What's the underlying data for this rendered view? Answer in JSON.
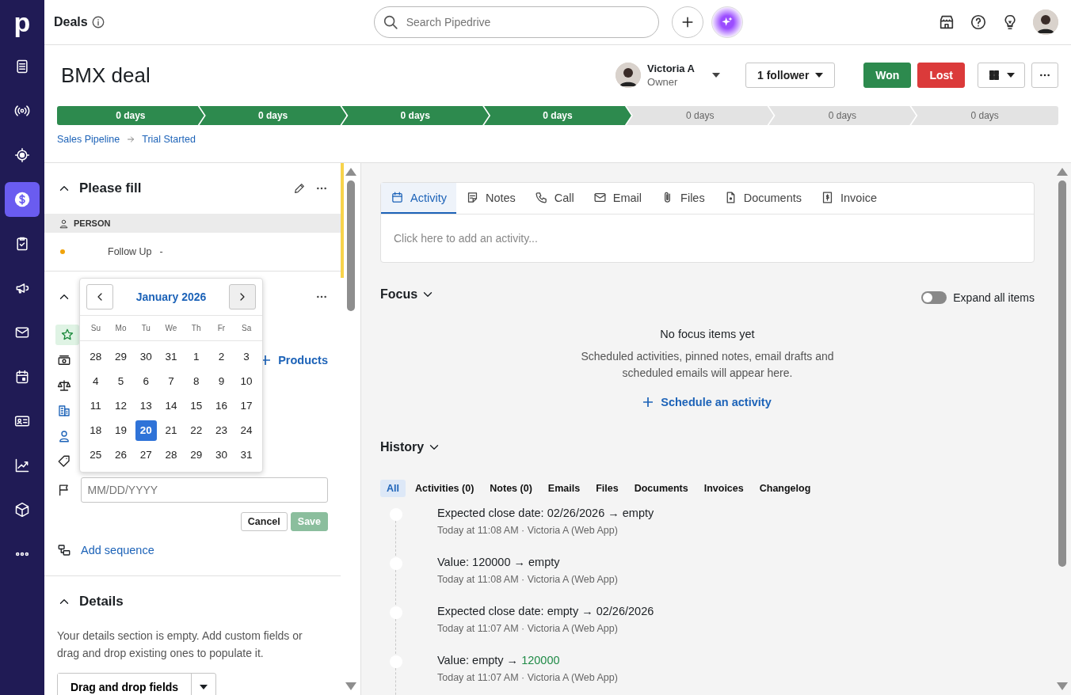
{
  "topbar": {
    "title": "Deals",
    "search": {
      "placeholder": "Search Pipedrive"
    }
  },
  "nav": {
    "logo": "p",
    "items": [
      {
        "kind": "leads",
        "selected": false
      },
      {
        "kind": "broadcast",
        "selected": false
      },
      {
        "kind": "target",
        "selected": false
      },
      {
        "kind": "deals",
        "selected": true
      },
      {
        "kind": "tasks",
        "selected": false
      },
      {
        "kind": "campaigns",
        "selected": false
      },
      {
        "kind": "mail",
        "selected": false
      },
      {
        "kind": "calendar",
        "selected": false
      },
      {
        "kind": "contacts",
        "selected": false
      },
      {
        "kind": "insights",
        "selected": false
      },
      {
        "kind": "products",
        "selected": false
      },
      {
        "kind": "more",
        "selected": false
      }
    ]
  },
  "deal": {
    "title": "BMX deal",
    "owner": {
      "name": "Victoria A",
      "role": "Owner"
    },
    "followers": "1 follower",
    "won": "Won",
    "lost": "Lost"
  },
  "pipeline": {
    "stages": [
      {
        "label": "0 days",
        "done": true
      },
      {
        "label": "0 days",
        "done": true
      },
      {
        "label": "0 days",
        "done": true
      },
      {
        "label": "0 days",
        "done": true
      },
      {
        "label": "0 days",
        "done": false
      },
      {
        "label": "0 days",
        "done": false
      },
      {
        "label": "0 days",
        "done": false
      }
    ]
  },
  "breadcrumb": [
    "Sales Pipeline",
    "Trial Started"
  ],
  "sidebar": {
    "please_fill": {
      "title": "Please fill",
      "group": "PERSON",
      "fields": [
        {
          "label": "Follow Up",
          "value": "-",
          "color": "#f0a30a"
        }
      ]
    },
    "summary": {
      "products_link": "Products",
      "date_field": {
        "placeholder": "MM/DD/YYYY"
      },
      "cancel": "Cancel",
      "save": {
        "label": "Save",
        "disabled": true
      },
      "sequence_link": "Add sequence"
    },
    "details": {
      "title": "Details",
      "text": "Your details section is empty. Add custom fields or drag and drop existing ones to populate it.",
      "button": "Drag and drop fields"
    }
  },
  "calendar": {
    "month": "January 2026",
    "weekdays": [
      "Su",
      "Mo",
      "Tu",
      "We",
      "Th",
      "Fr",
      "Sa"
    ],
    "weeks": [
      [
        {
          "day": "28",
          "selected": false
        },
        {
          "day": "29",
          "selected": false
        },
        {
          "day": "30",
          "selected": false
        },
        {
          "day": "31",
          "selected": false
        },
        {
          "day": "1",
          "selected": false
        },
        {
          "day": "2",
          "selected": false
        },
        {
          "day": "3",
          "selected": false
        }
      ],
      [
        {
          "day": "4",
          "selected": false
        },
        {
          "day": "5",
          "selected": false
        },
        {
          "day": "6",
          "selected": false
        },
        {
          "day": "7",
          "selected": false
        },
        {
          "day": "8",
          "selected": false
        },
        {
          "day": "9",
          "selected": false
        },
        {
          "day": "10",
          "selected": false
        }
      ],
      [
        {
          "day": "11",
          "selected": false
        },
        {
          "day": "12",
          "selected": false
        },
        {
          "day": "13",
          "selected": false
        },
        {
          "day": "14",
          "selected": false
        },
        {
          "day": "15",
          "selected": false
        },
        {
          "day": "16",
          "selected": false
        },
        {
          "day": "17",
          "selected": false
        }
      ],
      [
        {
          "day": "18",
          "selected": false
        },
        {
          "day": "19",
          "selected": false
        },
        {
          "day": "20",
          "selected": true
        },
        {
          "day": "21",
          "selected": false
        },
        {
          "day": "22",
          "selected": false
        },
        {
          "day": "23",
          "selected": false
        },
        {
          "day": "24",
          "selected": false
        }
      ],
      [
        {
          "day": "25",
          "selected": false
        },
        {
          "day": "26",
          "selected": false
        },
        {
          "day": "27",
          "selected": false
        },
        {
          "day": "28",
          "selected": false
        },
        {
          "day": "29",
          "selected": false
        },
        {
          "day": "30",
          "selected": false
        },
        {
          "day": "31",
          "selected": false
        }
      ]
    ]
  },
  "composer": {
    "tabs": [
      {
        "label": "Activity",
        "kind": "activity",
        "selected": true
      },
      {
        "label": "Notes",
        "kind": "notes",
        "selected": false
      },
      {
        "label": "Call",
        "kind": "call",
        "selected": false
      },
      {
        "label": "Email",
        "kind": "email",
        "selected": false
      },
      {
        "label": "Files",
        "kind": "files",
        "selected": false
      },
      {
        "label": "Documents",
        "kind": "documents",
        "selected": false
      },
      {
        "label": "Invoice",
        "kind": "invoice",
        "selected": false
      }
    ],
    "placeholder": "Click here to add an activity..."
  },
  "focus": {
    "title": "Focus",
    "expand": {
      "label": "Expand all items",
      "on": false
    },
    "empty_title": "No focus items yet",
    "empty_text": "Scheduled activities, pinned notes, email drafts and scheduled emails will appear here.",
    "action": "Schedule an activity"
  },
  "history": {
    "title": "History",
    "filters": [
      {
        "label": "All",
        "selected": true
      },
      {
        "label": "Activities (0)",
        "selected": false
      },
      {
        "label": "Notes (0)",
        "selected": false
      },
      {
        "label": "Emails",
        "selected": false
      },
      {
        "label": "Files",
        "selected": false
      },
      {
        "label": "Documents",
        "selected": false
      },
      {
        "label": "Invoices",
        "selected": false
      },
      {
        "label": "Changelog",
        "selected": false
      }
    ],
    "items": [
      {
        "change": "Expected close date: 02/26/2026 →",
        "result": "empty",
        "added": false,
        "meta": "Today at 11:08 AM · Victoria A (Web App)"
      },
      {
        "change": "Value: 120000 →",
        "result": "empty",
        "added": false,
        "meta": "Today at 11:08 AM · Victoria A (Web App)"
      },
      {
        "change": "Expected close date: empty →",
        "result": "02/26/2026",
        "added": false,
        "meta": "Today at 11:07 AM · Victoria A (Web App)"
      },
      {
        "change": "Value: empty →",
        "result": "120000",
        "added": true,
        "meta": "Today at 11:07 AM · Victoria A (Web App)"
      }
    ]
  }
}
